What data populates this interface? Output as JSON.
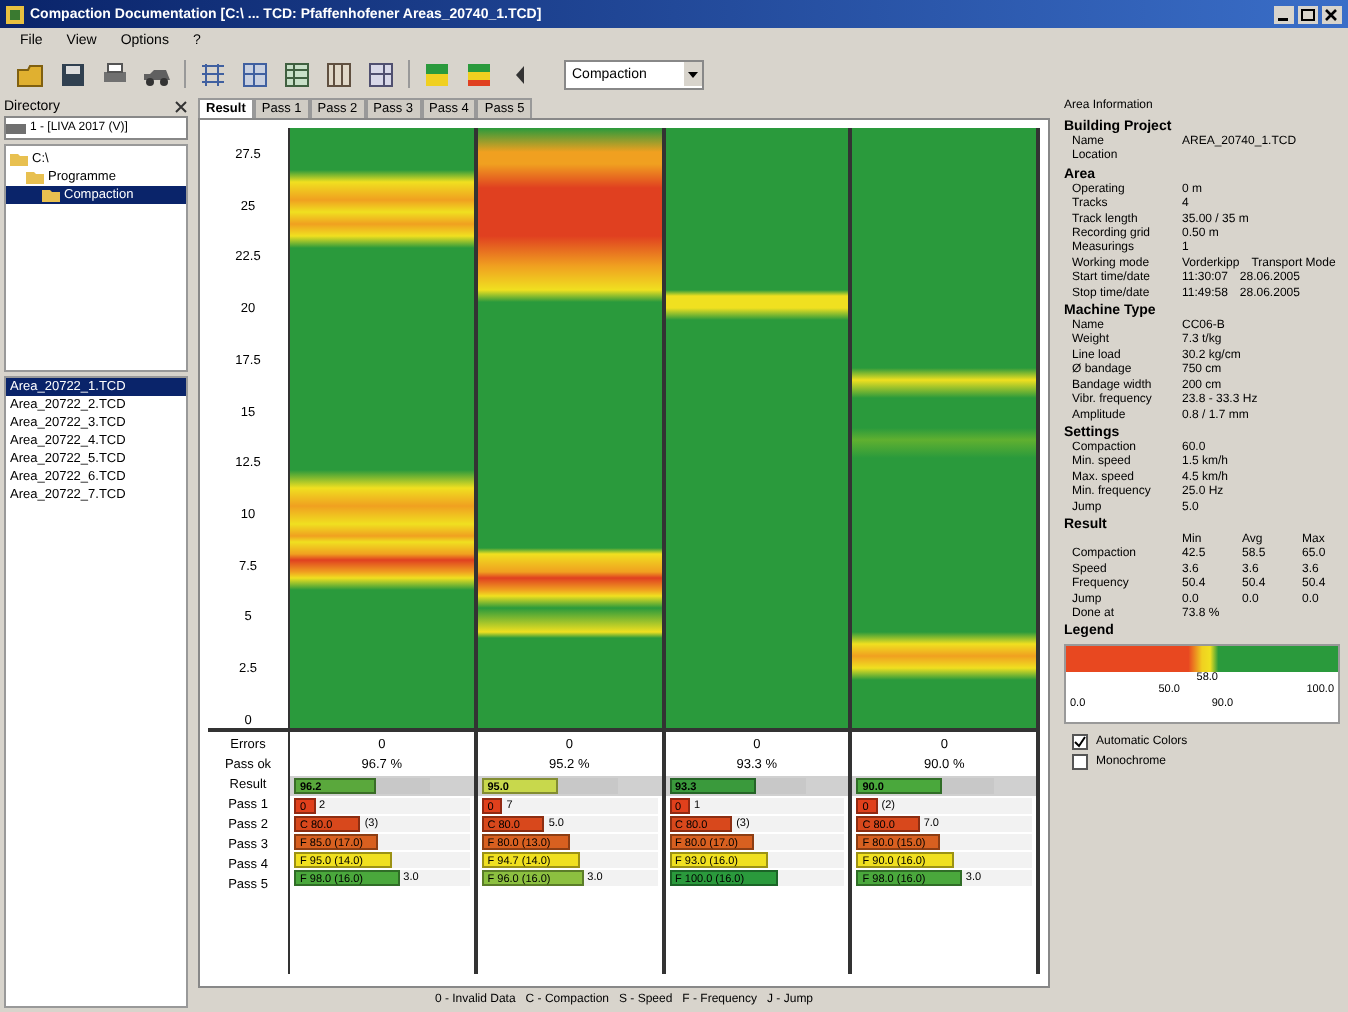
{
  "window": {
    "title": "Compaction Documentation [C:\\ ... TCD: Pfaffenhofener Areas_20740_1.TCD]"
  },
  "menu": [
    "File",
    "View",
    "Options",
    "?"
  ],
  "toolbar": {
    "dropdown": "Compaction"
  },
  "directory": {
    "header": "Directory",
    "drive": "1 - [LIVA 2017 (V)]",
    "tree": [
      {
        "label": "C:\\",
        "selected": false,
        "children": [
          {
            "label": "Programme",
            "selected": false,
            "children": [
              {
                "label": "Compaction",
                "selected": true
              }
            ]
          }
        ]
      }
    ],
    "files": [
      {
        "name": "Area_20722_1.TCD",
        "selected": true
      },
      {
        "name": "Area_20722_2.TCD",
        "selected": false
      },
      {
        "name": "Area_20722_3.TCD",
        "selected": false
      },
      {
        "name": "Area_20722_4.TCD",
        "selected": false
      },
      {
        "name": "Area_20722_5.TCD",
        "selected": false
      },
      {
        "name": "Area_20722_6.TCD",
        "selected": false
      },
      {
        "name": "Area_20722_7.TCD",
        "selected": false
      }
    ]
  },
  "tabs": [
    {
      "label": "Result",
      "selected": true
    },
    {
      "label": "Pass 1",
      "selected": false
    },
    {
      "label": "Pass 2",
      "selected": false
    },
    {
      "label": "Pass 3",
      "selected": false
    },
    {
      "label": "Pass 4",
      "selected": false
    },
    {
      "label": "Pass 5",
      "selected": false
    }
  ],
  "chart": {
    "axis_labels": [
      "27.5",
      "25",
      "22.5",
      "20",
      "17.5",
      "15",
      "12.5",
      "10",
      "7.5",
      "5",
      "2.5",
      "0"
    ],
    "row_headers": [
      "Errors",
      "Pass ok",
      "Result",
      "Pass 1",
      "Pass 2",
      "Pass 3",
      "Pass 4",
      "Pass 5"
    ],
    "columns": [
      {
        "errors": "0",
        "pass_ok": "96.7 %",
        "result": {
          "label": "96.2",
          "level": 0.6,
          "color": "#5aa83c"
        },
        "passes": [
          {
            "label": "0",
            "note": "2",
            "level": 0.12,
            "color": "#e0401c"
          },
          {
            "label": "C 80.0",
            "note": "(3)",
            "level": 0.38,
            "color": "#d8481c"
          },
          {
            "label": "F 85.0 (17.0)",
            "level": 0.48,
            "color": "#d86020"
          },
          {
            "label": "F 95.0 (14.0)",
            "level": 0.56,
            "color": "#f0e020"
          },
          {
            "label": "F 98.0 (16.0)",
            "note": "3.0",
            "level": 0.6,
            "color": "#4aa83c"
          }
        ]
      },
      {
        "errors": "0",
        "pass_ok": "95.2 %",
        "result": {
          "label": "95.0",
          "level": 0.56,
          "color": "#c8d84c"
        },
        "passes": [
          {
            "label": "0",
            "note": "7",
            "level": 0.12,
            "color": "#e0401c"
          },
          {
            "label": "C 80.0",
            "note": "5.0",
            "level": 0.36,
            "color": "#d8481c"
          },
          {
            "label": "F 80.0 (13.0)",
            "level": 0.5,
            "color": "#d86020"
          },
          {
            "label": "F 94.7 (14.0)",
            "level": 0.56,
            "color": "#f0e020"
          },
          {
            "label": "F 96.0 (16.0)",
            "note": "3.0",
            "level": 0.58,
            "color": "#8cc040"
          }
        ]
      },
      {
        "errors": "0",
        "pass_ok": "93.3 %",
        "result": {
          "label": "93.3",
          "level": 0.64,
          "color": "#3a9a3c"
        },
        "passes": [
          {
            "label": "0",
            "note": "1",
            "level": 0.12,
            "color": "#e0401c"
          },
          {
            "label": "C 80.0",
            "note": "(3)",
            "level": 0.36,
            "color": "#d8481c"
          },
          {
            "label": "F 80.0 (17.0)",
            "level": 0.48,
            "color": "#d86020"
          },
          {
            "label": "F 93.0 (16.0)",
            "level": 0.56,
            "color": "#f0e020"
          },
          {
            "label": "F 100.0 (16.0)",
            "level": 0.62,
            "color": "#2a9a3c"
          }
        ]
      },
      {
        "errors": "0",
        "pass_ok": "90.0 %",
        "result": {
          "label": "90.0",
          "level": 0.62,
          "color": "#4aa83c"
        },
        "passes": [
          {
            "label": "0",
            "note": "(2)",
            "level": 0.12,
            "color": "#e0401c"
          },
          {
            "label": "C 80.0",
            "note": "7.0",
            "level": 0.36,
            "color": "#d8481c"
          },
          {
            "label": "F 80.0 (15.0)",
            "level": 0.48,
            "color": "#d86020"
          },
          {
            "label": "F 90.0 (16.0)",
            "level": 0.56,
            "color": "#f0e020"
          },
          {
            "label": "F 98.0 (16.0)",
            "note": "3.0",
            "level": 0.6,
            "color": "#4aa83c"
          }
        ]
      }
    ],
    "footer": "0 - Invalid Data   C - Compaction   S - Speed   F - Frequency   J - Jump"
  },
  "info": {
    "title": "Area Information",
    "sections": [
      {
        "heading": "Building Project",
        "rows": [
          {
            "label": "Name",
            "values": [
              "AREA_20740_1.TCD"
            ]
          },
          {
            "label": "Location",
            "values": []
          }
        ]
      },
      {
        "heading": "Area",
        "rows": [
          {
            "label": "Operating",
            "values": [
              "0 m"
            ]
          },
          {
            "label": "Tracks",
            "values": [
              "4"
            ]
          },
          {
            "label": "Track length",
            "values": [
              "35.00 / 35 m"
            ]
          },
          {
            "label": "Recording grid",
            "values": [
              "0.50 m"
            ]
          },
          {
            "label": "Measurings",
            "values": [
              "1"
            ]
          },
          {
            "label": "Working mode",
            "values": [
              "Vorderkipp",
              "Transport Mode"
            ]
          },
          {
            "label": "Start time/date",
            "values": [
              "11:30:07",
              "28.06.2005"
            ]
          },
          {
            "label": "Stop time/date",
            "values": [
              "11:49:58",
              "28.06.2005"
            ]
          }
        ]
      },
      {
        "heading": "Machine Type",
        "rows": [
          {
            "label": "Name",
            "values": [
              "CC06-B"
            ]
          },
          {
            "label": "Weight",
            "values": [
              "7.3 t/kg"
            ]
          },
          {
            "label": "Line load",
            "values": [
              "30.2 kg/cm"
            ]
          },
          {
            "label": "Ø bandage",
            "values": [
              "750 cm"
            ]
          },
          {
            "label": "Bandage width",
            "values": [
              "200 cm"
            ]
          },
          {
            "label": "Vibr. frequency",
            "values": [
              "23.8 - 33.3 Hz"
            ]
          },
          {
            "label": "Amplitude",
            "values": [
              "0.8 / 1.7 mm"
            ]
          }
        ]
      },
      {
        "heading": "Settings",
        "rows": [
          {
            "label": "Compaction",
            "values": [
              "60.0"
            ]
          },
          {
            "label": "Min. speed",
            "values": [
              "1.5 km/h"
            ]
          },
          {
            "label": "Max. speed",
            "values": [
              "4.5 km/h"
            ]
          },
          {
            "label": "Min. frequency",
            "values": [
              "25.0 Hz"
            ]
          },
          {
            "label": "Jump",
            "values": [
              "5.0"
            ]
          }
        ]
      },
      {
        "heading": "Result",
        "columns": [
          "Min",
          "Avg",
          "Max"
        ],
        "rows": [
          {
            "label": "Compaction",
            "values": [
              "42.5",
              "58.5",
              "65.0"
            ]
          },
          {
            "label": "Speed",
            "values": [
              "3.6",
              "3.6",
              "3.6"
            ]
          },
          {
            "label": "Frequency",
            "values": [
              "50.4",
              "50.4",
              "50.4"
            ]
          },
          {
            "label": "Jump",
            "values": [
              "0.0",
              "0.0",
              "0.0"
            ]
          },
          {
            "label": "Done at",
            "values": [
              "73.8 %"
            ]
          }
        ]
      }
    ],
    "legend": {
      "heading": "Legend",
      "markers": [
        "58.0",
        "50.0",
        "100.0"
      ],
      "ends": [
        "0.0",
        "90.0"
      ]
    },
    "options": [
      {
        "label": "Automatic Colors",
        "checked": true
      },
      {
        "label": "Monochrome",
        "checked": false
      }
    ]
  }
}
